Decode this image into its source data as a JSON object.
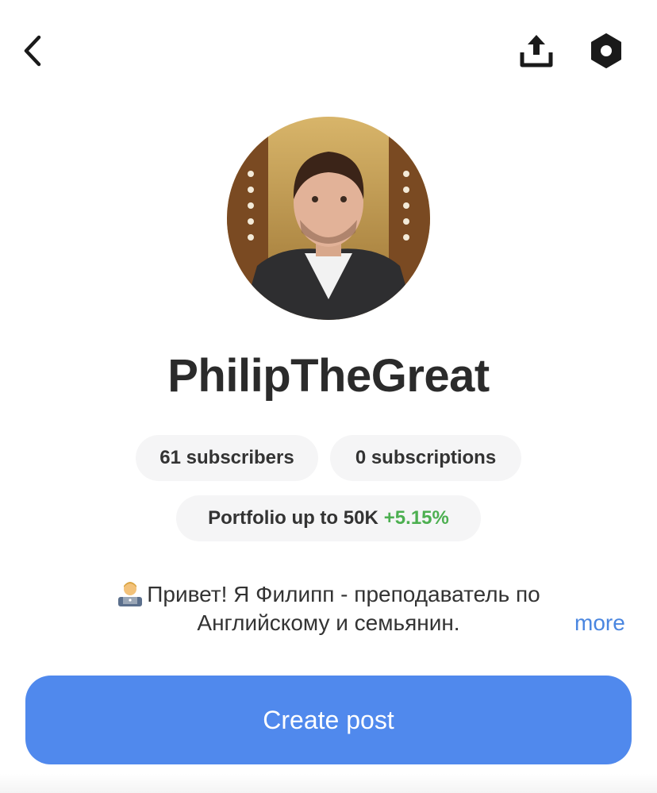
{
  "header": {
    "back_icon": "chevron-left-icon",
    "share_icon": "share-upload-icon",
    "settings_icon": "hexagon-settings-icon"
  },
  "profile": {
    "avatar_icon": "user-avatar-photo",
    "username": "PhilipTheGreat"
  },
  "stats": {
    "subscribers": "61 subscribers",
    "subscriptions": "0 subscriptions"
  },
  "portfolio": {
    "label": "Portfolio up to 50K",
    "change": "+5.15%",
    "change_color": "#4caf50"
  },
  "bio": {
    "emoji": "👨‍💻",
    "line1": "Привет! Я Филипп - преподаватель по",
    "line2": "Английскому и семьянин.",
    "more_label": "more"
  },
  "actions": {
    "create_post_label": "Create post",
    "accent_color": "#5089ed"
  }
}
